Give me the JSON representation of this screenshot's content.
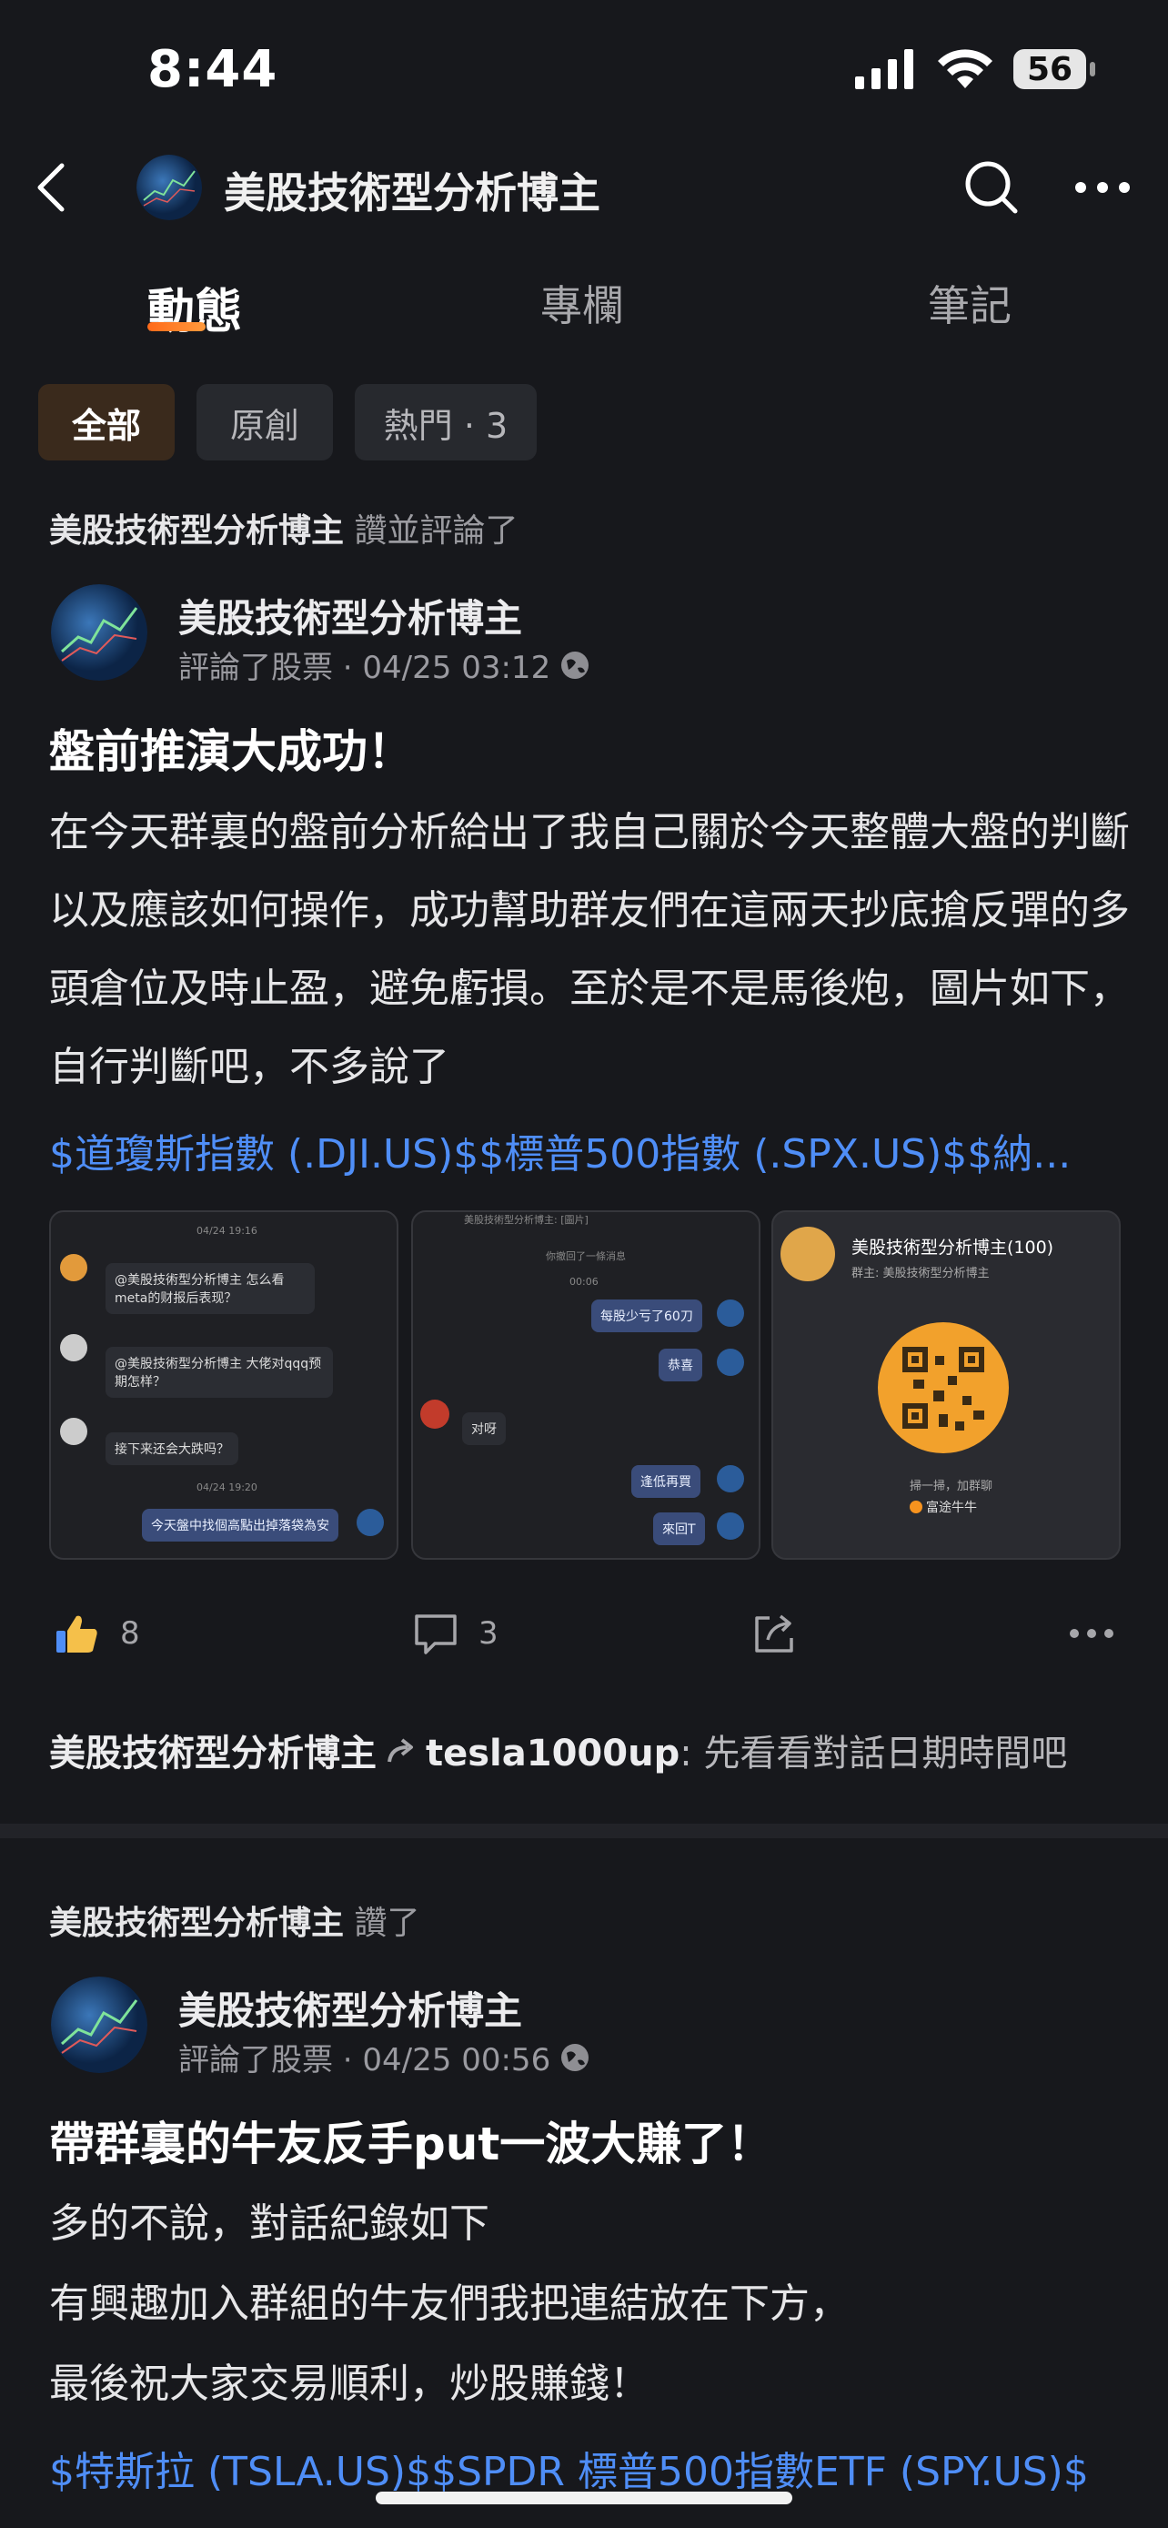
{
  "status": {
    "time": "8:44",
    "battery": "56"
  },
  "header": {
    "title": "美股技術型分析博主"
  },
  "tabs": [
    "動態",
    "專欄",
    "筆記"
  ],
  "filters": [
    "全部",
    "原創",
    "熱門 · 3"
  ],
  "posts": [
    {
      "activity_author": "美股技術型分析博主",
      "activity_action": "讚並評論了",
      "author": "美股技術型分析博主",
      "meta": "評論了股票 · 04/25 03:12",
      "title": "盤前推演大成功！",
      "body": "在今天群裏的盤前分析給出了我自己關於今天整體大盤的判斷以及應該如何操作，成功幫助群友們在這兩天抄底搶反彈的多頭倉位及時止盈，避免虧損。至於是不是馬後炮，圖片如下，自行判斷吧，不多說了",
      "tags": "$道瓊斯指數 (.DJI.US)$$標普500指數 (.SPX.US)$$納...",
      "thumbs": {
        "chat1": {
          "date1": "04/24 19:16",
          "q1": "@美股技術型分析博主 怎么看meta的财报后表现？",
          "q2": "@美股技術型分析博主 大佬对qqq预期怎样？",
          "q3": "接下来还会大跌吗？",
          "date2": "04/24 19:20",
          "reply": "今天盤中找個高點出掉落袋為安"
        },
        "chat2": {
          "top": "美股技術型分析博主: [圖片]",
          "note": "你撤回了一條消息",
          "time": "00:06",
          "m1": "每股少亏了60刀",
          "m2": "恭喜",
          "m3": "对呀",
          "m4": "逢低再買",
          "m5": "來回T"
        },
        "qr": {
          "title": "美股技術型分析博主(100)",
          "sub": "群主: 美股技術型分析博主",
          "hint": "掃一掃，加群聊",
          "brand": "富途牛牛"
        }
      },
      "likes": "8",
      "comments": "3",
      "comment_preview": {
        "from": "美股技術型分析博主",
        "to": "tesla1000up",
        "text": ": 先看看對話日期時間吧"
      }
    },
    {
      "activity_author": "美股技術型分析博主",
      "activity_action": "讚了",
      "author": "美股技術型分析博主",
      "meta": "評論了股票 · 04/25 00:56",
      "title": "帶群裏的牛友反手put一波大賺了！",
      "body_lines": [
        "多的不說，對話紀錄如下",
        "有興趣加入群組的牛友們我把連結放在下方，",
        "最後祝大家交易順利，炒股賺錢！"
      ],
      "tags": "$特斯拉 (TSLA.US)$$SPDR 標普500指數ETF (SPY.US)$"
    }
  ]
}
